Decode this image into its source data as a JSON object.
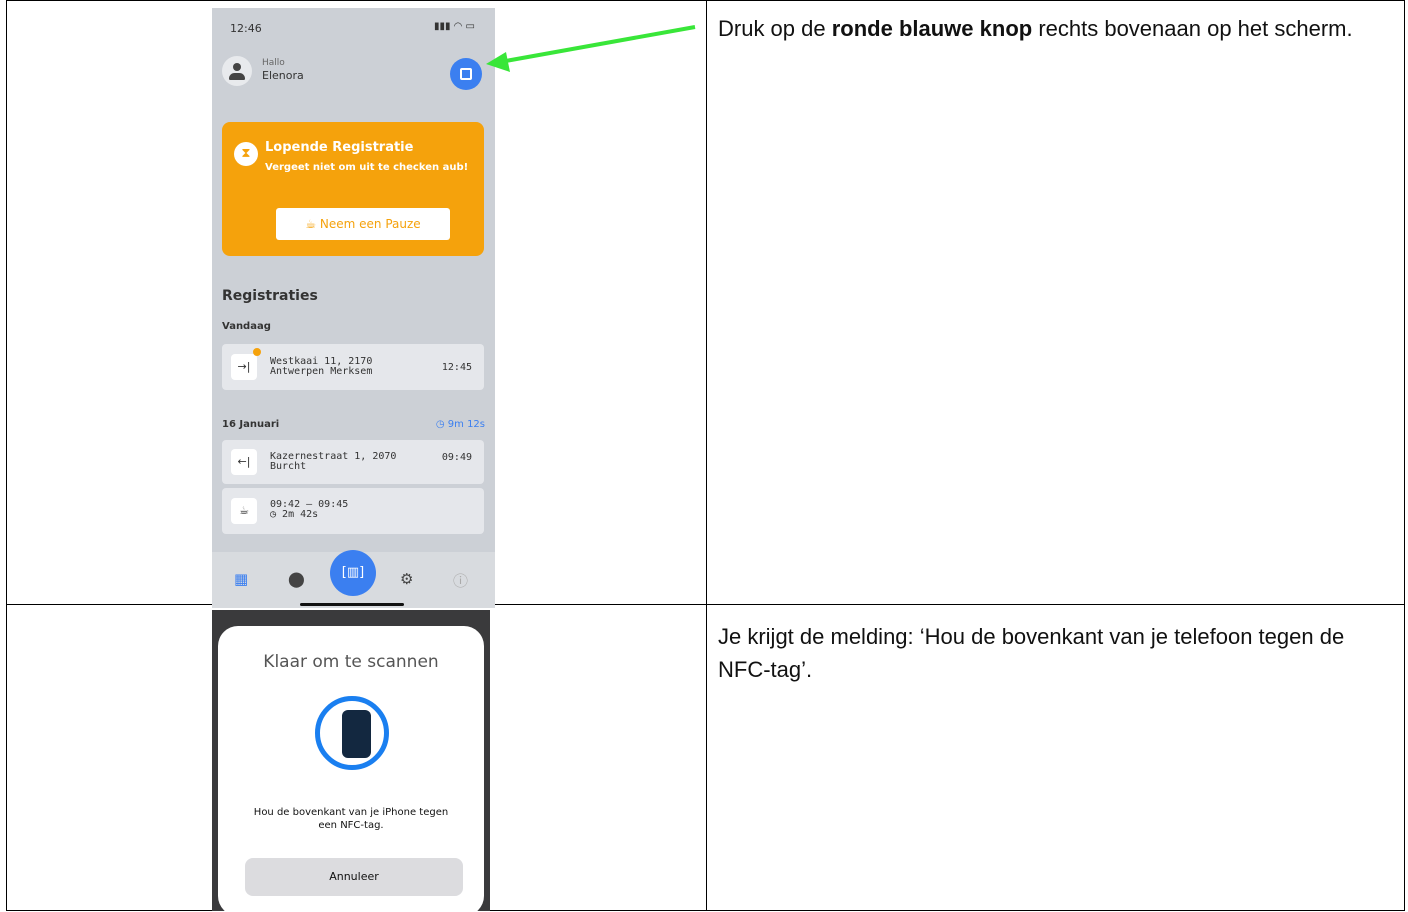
{
  "steps": [
    {
      "instruction_prefix": "Druk op de ",
      "instruction_bold": "ronde blauwe knop",
      "instruction_suffix": " rechts bovenaan op het scherm."
    },
    {
      "instruction": "Je krijgt de melding: ‘Hou de bovenkant van je telefoon tegen de NFC-tag’."
    }
  ],
  "phone1": {
    "status_time": "12:46",
    "greeting": "Hallo",
    "user_name": "Elenora",
    "banner": {
      "title": "Lopende Registratie",
      "subtitle": "Vergeet niet om uit te checken aub!",
      "button_label": "Neem een Pauze",
      "color": "#f5a20c"
    },
    "registrations_heading": "Registraties",
    "today_label": "Vandaag",
    "today_entry": {
      "address_line1": "Westkaai 11, 2170",
      "address_line2": "Antwerpen Merksem",
      "time": "12:45"
    },
    "day_label": "16 Januari",
    "day_duration": "9m 12s",
    "day_entries": [
      {
        "address_line1": "Kazernestraat 1, 2070",
        "address_line2": "Burcht",
        "time": "09:49"
      },
      {
        "range": "09:42  —  09:45",
        "duration": "2m 42s"
      }
    ],
    "accent": "#3b7ff0"
  },
  "phone2": {
    "title": "Klaar om te scannen",
    "message_line1": "Hou de bovenkant van je iPhone tegen",
    "message_line2": "een NFC-tag.",
    "cancel_label": "Annuleer",
    "accent": "#1a7ff0"
  }
}
